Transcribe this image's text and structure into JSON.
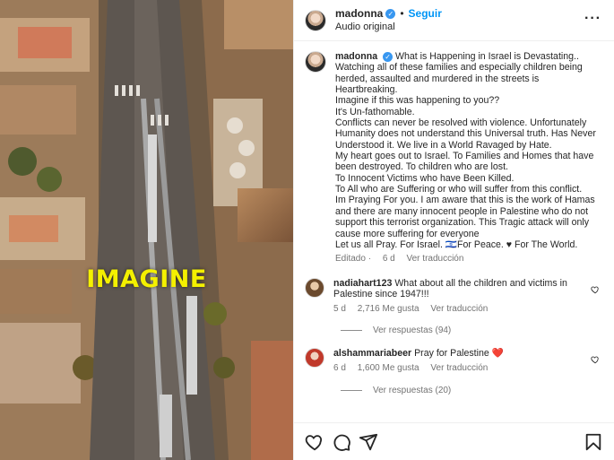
{
  "header": {
    "username": "madonna",
    "follow_label": "Seguir",
    "audio_label": "Audio original",
    "separator": "•",
    "more_label": "···"
  },
  "media": {
    "overlay_word": "IMAGINE"
  },
  "post": {
    "username": "madonna",
    "caption_lines": [
      "What is Happening in Israel is Devastating..",
      "Watching all of these families and especially children being herded, assaulted and murdered in the streets is Heartbreaking.",
      "Imagine if this was happening to you??",
      "It's Un-fathomable.",
      "Conflicts can never be resolved with violence. Unfortunately Humanity does not understand this Universal truth. Has Never Understood it. We live in a World Ravaged by Hate.",
      "My heart goes out to Israel. To Families and Homes that have been destroyed. To children who are lost.",
      "To Innocent Victims who have Been Killed.",
      "To All who are Suffering or who will suffer from this conflict.",
      "Im Praying For you. I am aware that this is the work of Hamas and there are many innocent people in Palestine who do not support this terrorist organization. This Tragic attack will only cause more suffering for everyone",
      "Let us all Pray. For Israel. 🇮🇱For Peace. ♥ For The World."
    ],
    "edited_label": "Editado",
    "time": "6 d",
    "translate_label": "Ver traducción"
  },
  "comments": [
    {
      "username": "nadiahart123",
      "text": "What about all the children and victims in Palestine since 1947!!!",
      "time": "5 d",
      "likes": "2,716 Me gusta",
      "translate_label": "Ver traducción",
      "replies_label": "Ver respuestas (94)"
    },
    {
      "username": "alshammariabeer",
      "text": "Pray for Palestine ❤️",
      "time": "6 d",
      "likes": "1,600 Me gusta",
      "translate_label": "Ver traducción",
      "replies_label": "Ver respuestas (20)"
    }
  ],
  "colors": {
    "accent": "#0095f6",
    "verified": "#3897f0",
    "overlay_text": "#f4f000",
    "muted": "#737373",
    "heart_red": "#e0245e"
  }
}
